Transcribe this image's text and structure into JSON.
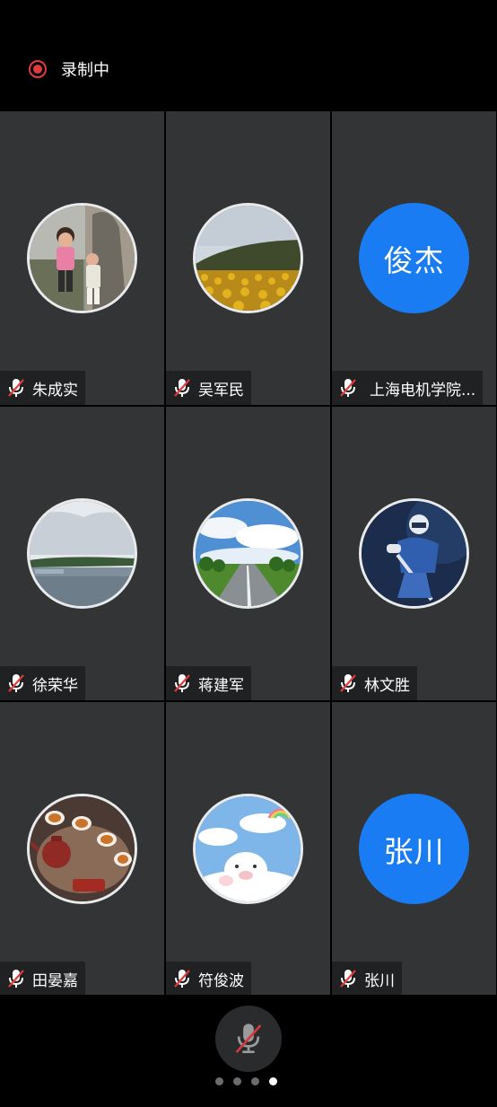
{
  "recording": {
    "label": "录制中",
    "icon": "record-icon",
    "color": "#e23b3b"
  },
  "participants": [
    {
      "name": "朱成实",
      "avatar_type": "photo",
      "avatar_desc": "children-photo",
      "muted": true
    },
    {
      "name": "吴军民",
      "avatar_type": "photo",
      "avatar_desc": "sunflower-field-photo",
      "muted": true
    },
    {
      "name": "上海电机学院...",
      "avatar_type": "text",
      "avatar_text": "俊杰",
      "muted": true
    },
    {
      "name": "徐荣华",
      "avatar_type": "photo",
      "avatar_desc": "lake-photo",
      "muted": true
    },
    {
      "name": "蒋建军",
      "avatar_type": "photo",
      "avatar_desc": "road-sky-photo",
      "muted": true
    },
    {
      "name": "林文胜",
      "avatar_type": "photo",
      "avatar_desc": "hockey-player-photo",
      "muted": true
    },
    {
      "name": "田晏嘉",
      "avatar_type": "photo",
      "avatar_desc": "tea-set-photo",
      "muted": true
    },
    {
      "name": "符俊波",
      "avatar_type": "photo",
      "avatar_desc": "cartoon-pig-photo",
      "muted": true
    },
    {
      "name": "张川",
      "avatar_type": "text",
      "avatar_text": "张川",
      "muted": true
    }
  ],
  "toolbar": {
    "mic_button_icon": "mic-muted-icon"
  },
  "pager": {
    "total": 4,
    "active": 4
  },
  "colors": {
    "tile_bg": "#323436",
    "text_avatar_bg": "#1a7cf2",
    "muted_icon": "#e23b3b"
  }
}
